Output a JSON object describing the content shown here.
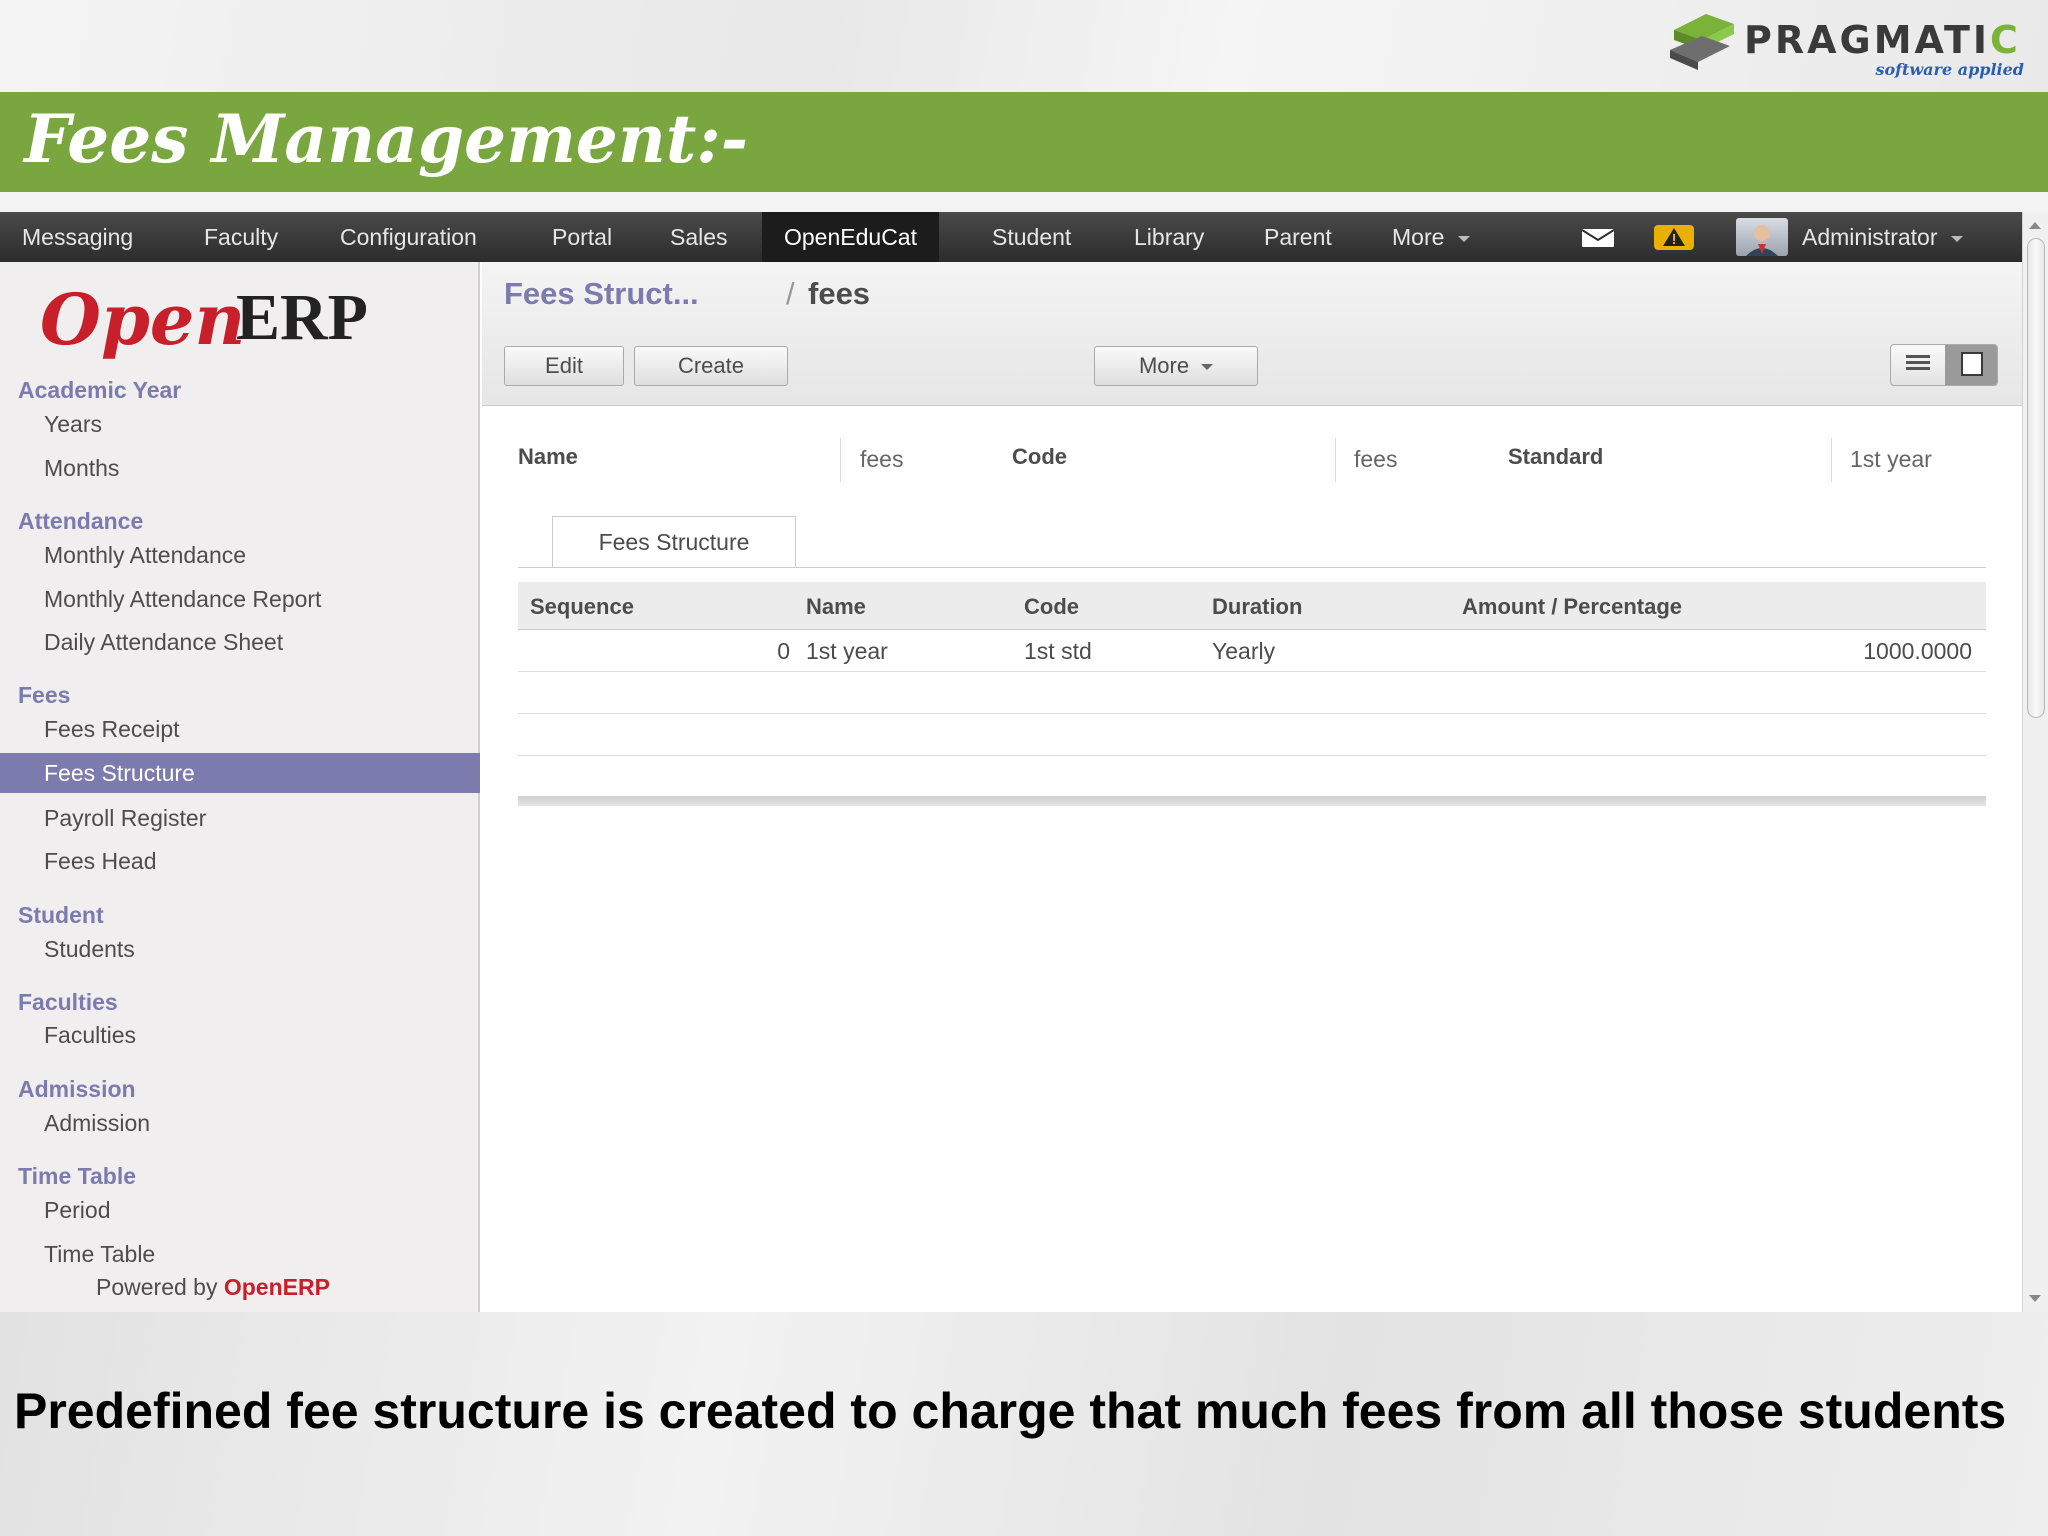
{
  "slide": {
    "brand_name_main": "PRAGMATI",
    "brand_name_accent": "C",
    "brand_tagline": "software applied",
    "title": "Fees Management:-",
    "caption": "Predefined fee structure is created to charge that much fees from all those students"
  },
  "colors": {
    "green_band": "#7aa63f",
    "sidebar_accent": "#7c7bad",
    "nav_bar": "#2c2c2c",
    "openerp_red": "#c8202a"
  },
  "topnav": {
    "items": [
      "Messaging",
      "Faculty",
      "Configuration",
      "Portal",
      "Sales",
      "OpenEduCat",
      "Student",
      "Library",
      "Parent",
      "More"
    ],
    "active": "OpenEduCat",
    "user": "Administrator",
    "icons": [
      "mail-icon",
      "alert-icon",
      "avatar"
    ]
  },
  "sidebar": {
    "logo_open": "Open",
    "logo_erp": "ERP",
    "sections": [
      {
        "title": "Academic Year",
        "items": [
          "Years",
          "Months"
        ]
      },
      {
        "title": "Attendance",
        "items": [
          "Monthly Attendance",
          "Monthly Attendance Report",
          "Daily Attendance Sheet"
        ]
      },
      {
        "title": "Fees",
        "items": [
          "Fees Receipt",
          "Fees Structure",
          "Payroll Register",
          "Fees Head"
        ]
      },
      {
        "title": "Student",
        "items": [
          "Students"
        ]
      },
      {
        "title": "Faculties",
        "items": [
          "Faculties"
        ]
      },
      {
        "title": "Admission",
        "items": [
          "Admission"
        ]
      },
      {
        "title": "Time Table",
        "items": [
          "Period",
          "Time Table"
        ]
      }
    ],
    "active_item": "Fees Structure",
    "powered_prefix": "Powered by",
    "powered_brand": "OpenERP"
  },
  "breadcrumb": {
    "parent": "Fees Struct...",
    "separator": "/",
    "current": "fees"
  },
  "toolbar": {
    "edit_label": "Edit",
    "create_label": "Create",
    "more_label": "More"
  },
  "form": {
    "fields": [
      {
        "label": "Name",
        "value": "fees"
      },
      {
        "label": "Code",
        "value": "fees"
      },
      {
        "label": "Standard",
        "value": "1st year"
      }
    ],
    "tab_label": "Fees Structure"
  },
  "grid": {
    "columns": [
      "Sequence",
      "Name",
      "Code",
      "Duration",
      "Amount / Percentage"
    ],
    "rows": [
      {
        "sequence": "0",
        "name": "1st year",
        "code": "1st std",
        "duration": "Yearly",
        "amount": "1000.0000"
      }
    ]
  }
}
